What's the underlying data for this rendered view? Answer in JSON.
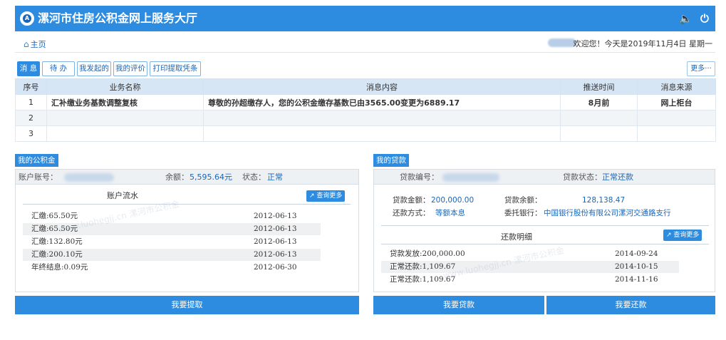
{
  "header": {
    "logo_text": "A",
    "title": "漯河市住房公积金网上服务大厅",
    "sound_icon": "speaker-icon",
    "power_icon": "power-icon"
  },
  "nav": {
    "home_label": "主页",
    "welcome_text": "欢迎您！今天是2019年11月4日 星期一"
  },
  "tabs": {
    "items": [
      "消 息",
      "待 办",
      "我发起的",
      "我的评价",
      "打印提取凭条"
    ],
    "more_label": "更多···"
  },
  "messages": {
    "columns": [
      "序号",
      "业务名称",
      "消息内容",
      "推送时间",
      "消息来源"
    ],
    "rows": [
      {
        "no": "1",
        "name": "汇补缴业务基数调整复核",
        "content": "尊敬的孙超缴存人，您的公积金缴存基数已由3565.00变更为6889.17",
        "time": "8月前",
        "source": "网上柜台"
      },
      {
        "no": "2",
        "name": "",
        "content": "",
        "time": "",
        "source": ""
      },
      {
        "no": "3",
        "name": "",
        "content": "",
        "time": "",
        "source": ""
      }
    ]
  },
  "fund": {
    "tag": "我的公积金",
    "account_label": "账户账号：",
    "balance_label": "余额：",
    "balance_value": "5,595.64元",
    "status_label": "状态：",
    "status_value": "正常",
    "flow_title": "账户流水",
    "query_more": "查询更多",
    "flow_rows": [
      {
        "desc": "汇缴:65.50元",
        "date": "2012-06-13"
      },
      {
        "desc": "汇缴:65.50元",
        "date": "2012-06-13"
      },
      {
        "desc": "汇缴:132.80元",
        "date": "2012-06-13"
      },
      {
        "desc": "汇缴:200.10元",
        "date": "2012-06-13"
      },
      {
        "desc": "年终结息:0.09元",
        "date": "2012-06-30"
      }
    ],
    "action_label": "我要提取"
  },
  "loan": {
    "tag": "我的贷款",
    "loan_no_label": "贷款编号：",
    "loan_status_label": "贷款状态：",
    "loan_status_value": "正常还款",
    "amount_label": "贷款金额：",
    "amount_value": "200,000.00",
    "remain_label": "贷款余额：",
    "remain_value": "128,138.47",
    "method_label": "还款方式：",
    "method_value": "等额本息",
    "bank_label": "委托银行：",
    "bank_value": "中国银行股份有限公司漯河交通路支行",
    "detail_title": "还款明细",
    "query_more": "查询更多",
    "detail_rows": [
      {
        "desc": "贷款发放:200,000.00",
        "date": "2014-09-24"
      },
      {
        "desc": "正常还款:1,109.67",
        "date": "2014-10-15"
      },
      {
        "desc": "正常还款:1,109.67",
        "date": "2014-11-16"
      }
    ],
    "apply_label": "我要贷款",
    "repay_label": "我要还款"
  },
  "watermark_text": "www.luohegjj.cn 漯河市公积金"
}
